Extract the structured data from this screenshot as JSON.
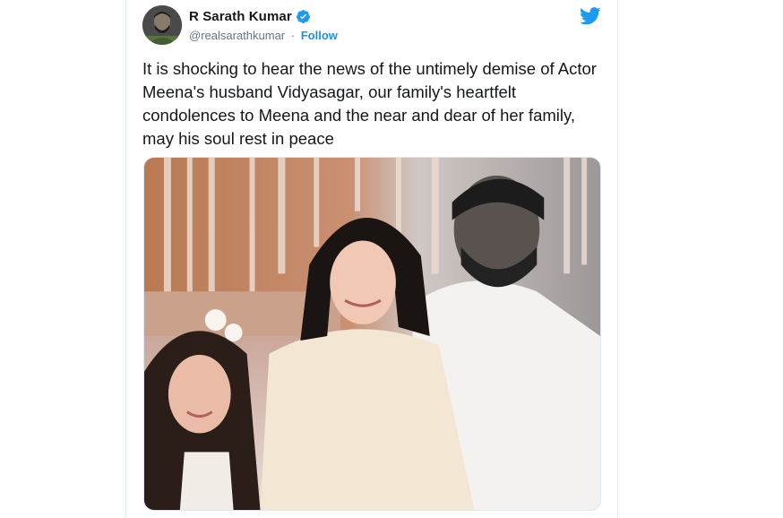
{
  "tweet": {
    "author": {
      "display_name": "R Sarath Kumar",
      "handle": "@realsarathkumar",
      "separator": "·",
      "follow_label": "Follow",
      "verified_icon": "verified-badge-icon",
      "avatar": "author-avatar"
    },
    "platform_icon": "twitter-bird-icon",
    "text": "It is shocking to hear the news of the untimely demise of Actor Meena's husband Vidyasagar, our family's heartfelt condolences to Meena and the near and dear of her family, may his soul rest in peace",
    "media": {
      "type": "photo",
      "description_icon": "family-photo"
    }
  },
  "colors": {
    "link": "#1b95e0",
    "verified": "#1d9bf0",
    "text": "#14171a",
    "muted": "#657786"
  }
}
